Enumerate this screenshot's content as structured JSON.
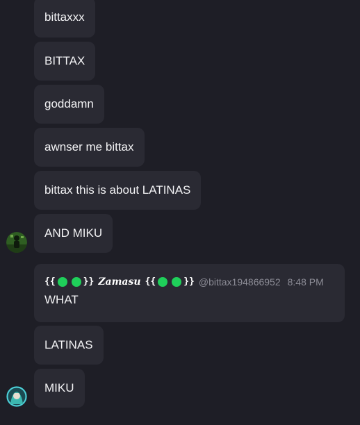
{
  "messages": [
    {
      "text": "bittaxxx"
    },
    {
      "text": "BITTAX"
    },
    {
      "text": "goddamn"
    },
    {
      "text": "awnser me bittax"
    },
    {
      "text": "bittax this is about LATINAS"
    },
    {
      "text": "AND MIKU"
    },
    {
      "author": {
        "open_brace": "{{",
        "close_brace": "}}",
        "name": "Zamasu",
        "handle": "@bittax194866952"
      },
      "time": "8:48 PM",
      "text": "WHAT"
    },
    {
      "text": "LATINAS"
    },
    {
      "text": "MIKU"
    }
  ],
  "avatars": {
    "user1": "green-figure-avatar",
    "user2": "miku-avatar"
  },
  "colors": {
    "background": "#1e1e26",
    "bubble": "#2a2a33",
    "emoji_dot": "#1fcf5a",
    "muted_text": "#8c8c96"
  }
}
